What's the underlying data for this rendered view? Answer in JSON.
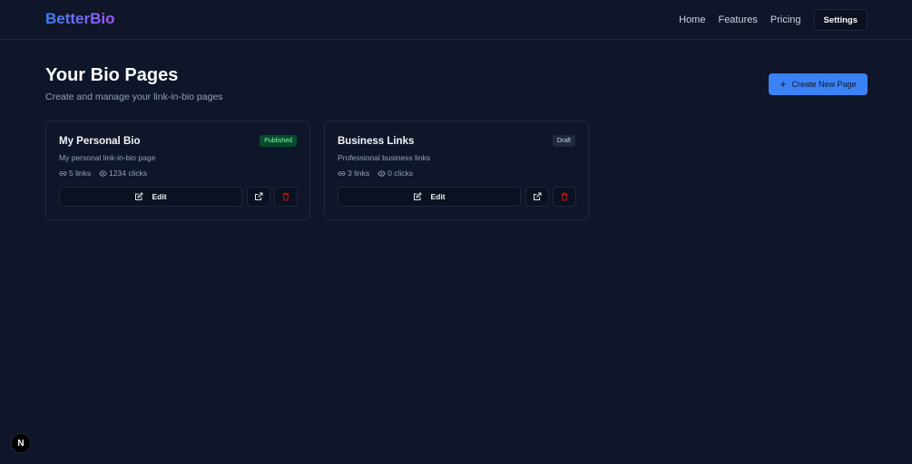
{
  "app": {
    "logo": "BetterBio",
    "nav": [
      {
        "label": "Home"
      },
      {
        "label": "Features"
      },
      {
        "label": "Pricing"
      }
    ],
    "settings_label": "Settings"
  },
  "header": {
    "title": "Your Bio Pages",
    "subtitle": "Create and manage your link-in-bio pages",
    "create_label": "Create New Page"
  },
  "cards": [
    {
      "title": "My Personal Bio",
      "description": "My personal link-in-bio page",
      "status": "Published",
      "links": "5 links",
      "clicks": "1234 clicks",
      "edit_label": "Edit"
    },
    {
      "title": "Business Links",
      "description": "Professional business links",
      "status": "Draft",
      "links": "3 links",
      "clicks": "0 clicks",
      "edit_label": "Edit"
    }
  ],
  "dev_badge": "N",
  "colors": {
    "background": "#0f1629",
    "accent": "#3b82f6",
    "published": "#064e2b",
    "danger": "#b91c1c"
  }
}
